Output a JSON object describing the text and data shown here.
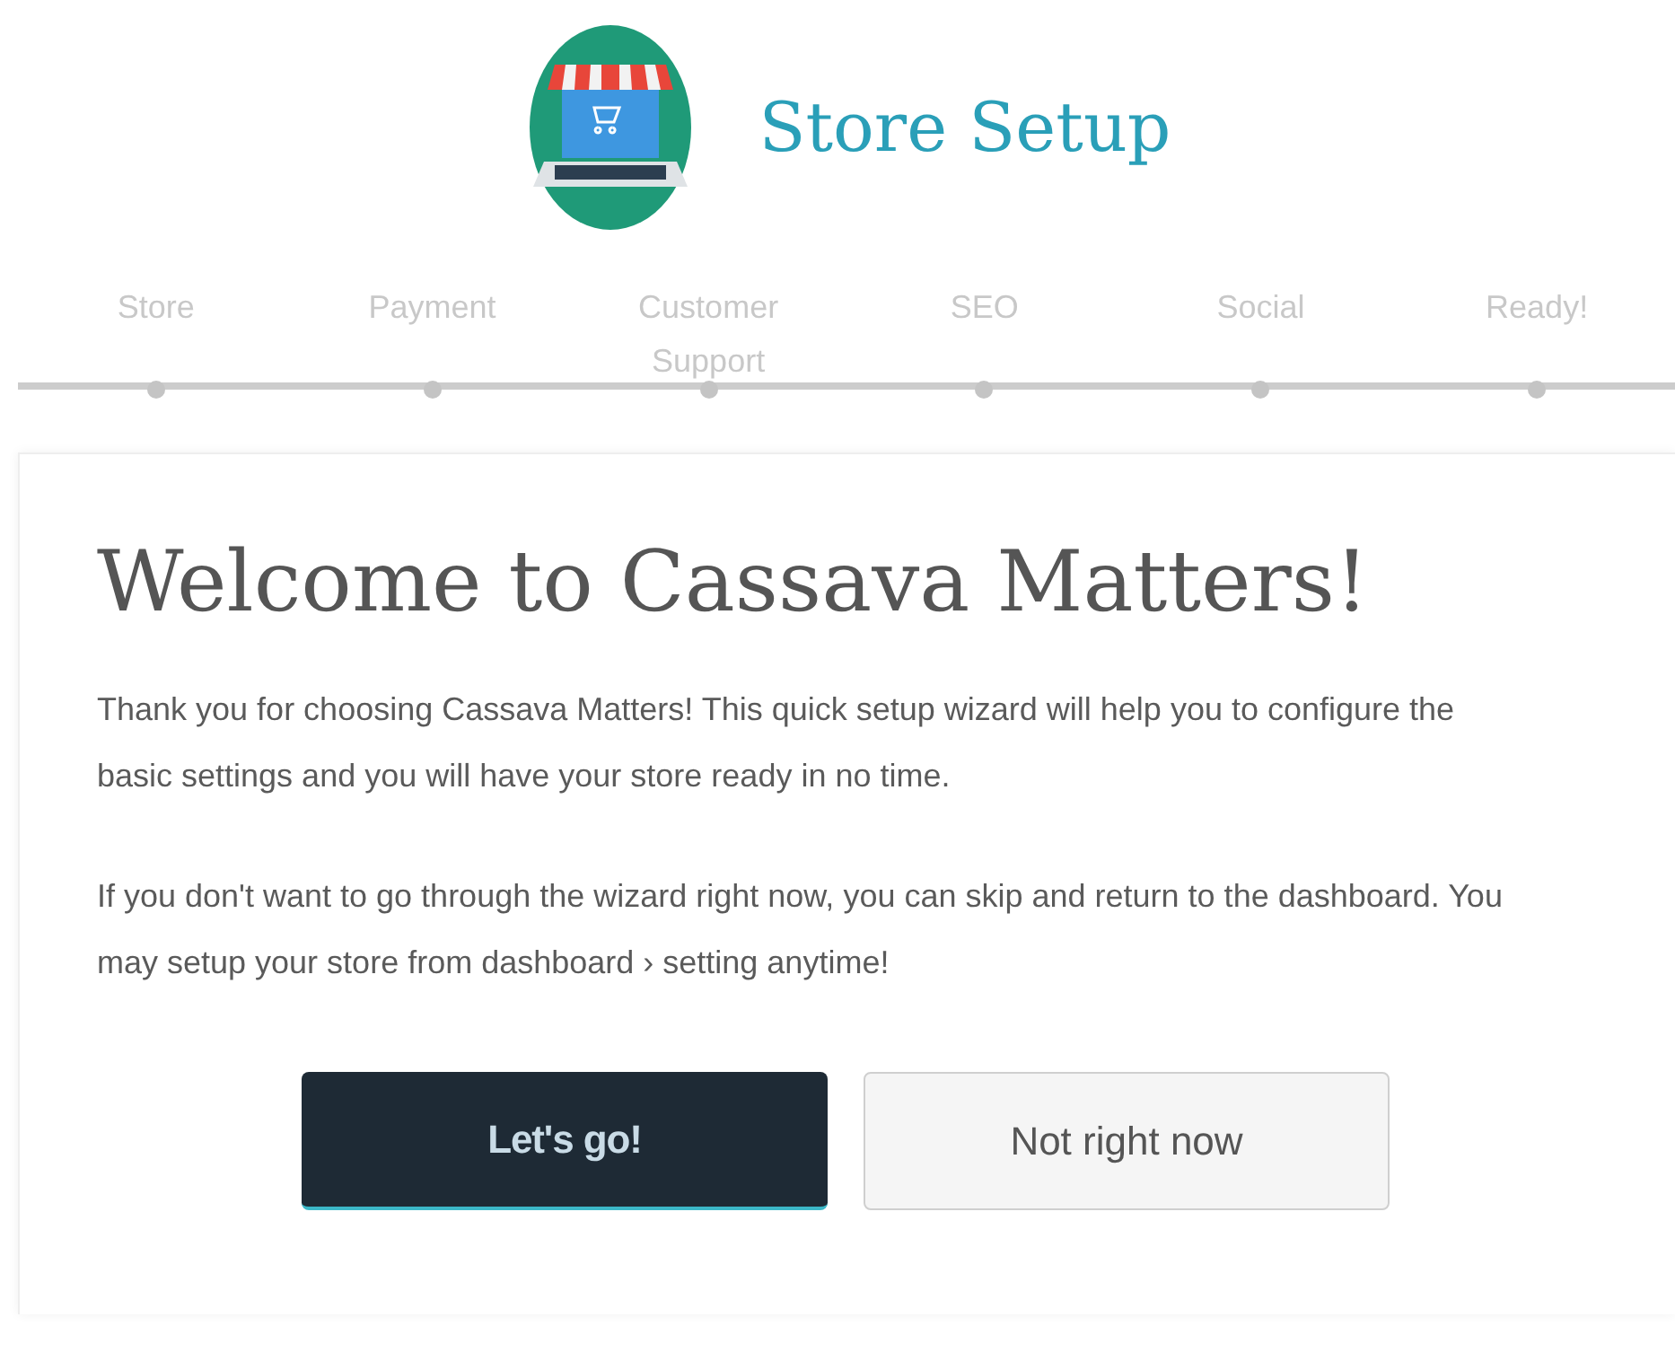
{
  "header": {
    "title": "Store Setup"
  },
  "steps": [
    {
      "label": "Store"
    },
    {
      "label": "Payment"
    },
    {
      "label": "Customer Support"
    },
    {
      "label": "SEO"
    },
    {
      "label": "Social"
    },
    {
      "label": "Ready!"
    }
  ],
  "card": {
    "heading": "Welcome to Cassava Matters!",
    "paragraphs": [
      "Thank you for choosing Cassava Matters! This quick setup wizard will help you to configure the basic settings and you will have your store ready in no time.",
      "If you don't want to go through the wizard right now, you can skip and return to the dashboard. You may setup your store from dashboard › setting anytime!"
    ],
    "buttons": [
      {
        "label": "Let's go!",
        "kind": "primary"
      },
      {
        "label": "Not right now",
        "kind": "secondary"
      }
    ]
  }
}
